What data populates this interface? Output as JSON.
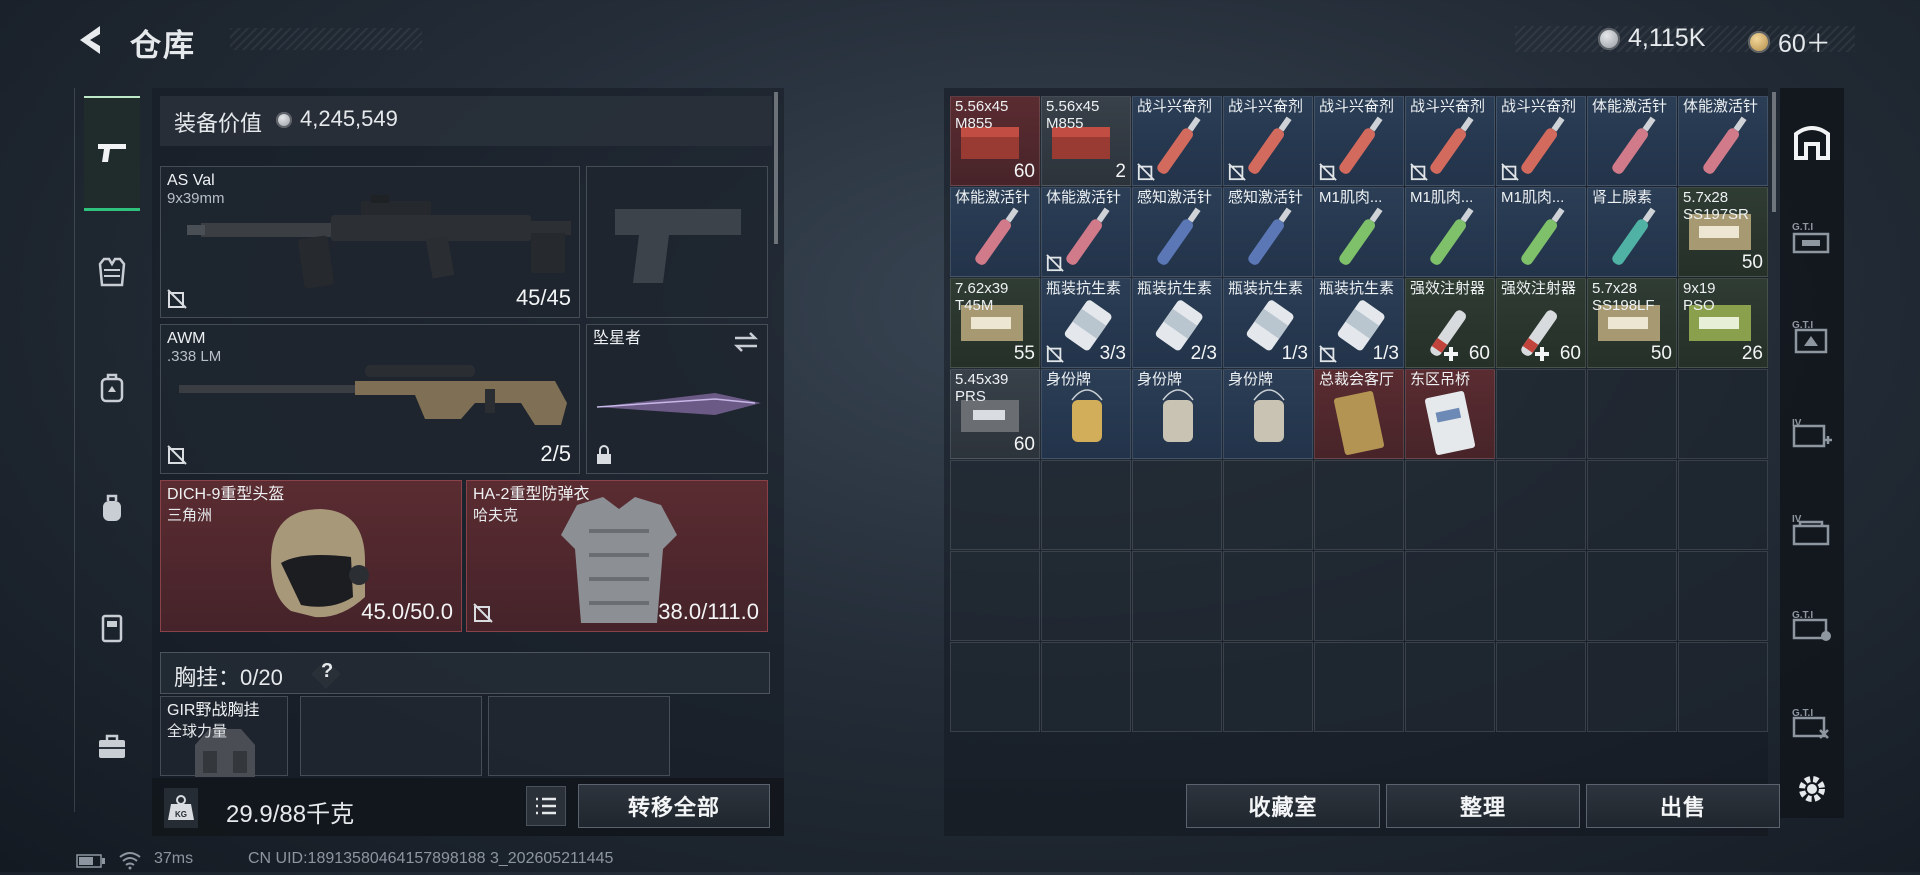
{
  "header": {
    "title": "仓库",
    "currency_1": "4,115K",
    "currency_2": "60＋"
  },
  "equipment": {
    "label": "装备价值",
    "value": "4,245,549",
    "primary_1": {
      "name": "AS Val",
      "sub": "9x39mm",
      "count": "45/45"
    },
    "primary_2": {
      "name": "AWM",
      "sub": ".338 LM",
      "count": "2/5"
    },
    "melee": {
      "name": "坠星者"
    },
    "helmet": {
      "name": "DICH-9重型头盔",
      "sub": "三角洲",
      "count": "45.0/50.0"
    },
    "armor": {
      "name": "HA-2重型防弹衣",
      "sub": "哈夫克",
      "count": "38.0/111.0"
    },
    "chest_rig_label": "胸挂：",
    "chest_rig_count": "0/20",
    "chest_rig_help": "?",
    "rig_item": {
      "name": "GIR野战胸挂",
      "sub": "全球力量"
    }
  },
  "bottom_left": {
    "weight": "29.9/88千克",
    "transfer_all": "转移全部"
  },
  "stash": {
    "rows": [
      [
        {
          "n1": "5.56x45",
          "n2": "M855",
          "count": "60",
          "kind": "ammo_red",
          "bg": "redc"
        },
        {
          "n1": "5.56x45",
          "n2": "M855",
          "count": "2",
          "kind": "ammo_red",
          "bg": "grey"
        },
        {
          "n1": "战斗兴奋剂",
          "count": "",
          "kind": "syringe_red",
          "bg": "blue",
          "broken": true
        },
        {
          "n1": "战斗兴奋剂",
          "count": "",
          "kind": "syringe_red",
          "bg": "blue",
          "broken": true
        },
        {
          "n1": "战斗兴奋剂",
          "count": "",
          "kind": "syringe_red",
          "bg": "blue",
          "broken": true
        },
        {
          "n1": "战斗兴奋剂",
          "count": "",
          "kind": "syringe_red",
          "bg": "blue",
          "broken": true
        },
        {
          "n1": "战斗兴奋剂",
          "count": "",
          "kind": "syringe_red",
          "bg": "blue",
          "broken": true
        },
        {
          "n1": "体能激活针",
          "count": "",
          "kind": "syringe_pink",
          "bg": "blue"
        },
        {
          "n1": "体能激活针",
          "count": "",
          "kind": "syringe_pink",
          "bg": "blue"
        }
      ],
      [
        {
          "n1": "体能激活针",
          "count": "",
          "kind": "syringe_pink",
          "bg": "blue"
        },
        {
          "n1": "体能激活针",
          "count": "",
          "kind": "syringe_pink",
          "bg": "blue",
          "broken": true
        },
        {
          "n1": "感知激活针",
          "count": "",
          "kind": "syringe_blue",
          "bg": "blue"
        },
        {
          "n1": "感知激活针",
          "count": "",
          "kind": "syringe_blue",
          "bg": "blue"
        },
        {
          "n1": "M1肌肉...",
          "count": "",
          "kind": "syringe_green",
          "bg": "blue"
        },
        {
          "n1": "M1肌肉...",
          "count": "",
          "kind": "syringe_green",
          "bg": "blue"
        },
        {
          "n1": "M1肌肉...",
          "count": "",
          "kind": "syringe_green",
          "bg": "blue"
        },
        {
          "n1": "肾上腺素",
          "count": "",
          "kind": "syringe_teal",
          "bg": "blue"
        },
        {
          "n1": "5.7x28",
          "n2": "SS197SR",
          "count": "50",
          "kind": "ammo_khaki",
          "bg": "green"
        }
      ],
      [
        {
          "n1": "7.62x39",
          "n2": "T45M",
          "count": "55",
          "kind": "ammo_khaki",
          "bg": "green"
        },
        {
          "n1": "瓶装抗生素",
          "count": "3/3",
          "kind": "bottle",
          "bg": "blue",
          "broken": true
        },
        {
          "n1": "瓶装抗生素",
          "count": "2/3",
          "kind": "bottle",
          "bg": "blue"
        },
        {
          "n1": "瓶装抗生素",
          "count": "1/3",
          "kind": "bottle",
          "bg": "blue"
        },
        {
          "n1": "瓶装抗生素",
          "count": "1/3",
          "kind": "bottle",
          "bg": "blue",
          "broken": true
        },
        {
          "n1": "强效注射器",
          "count": "60",
          "kind": "syringe_white",
          "bg": "green",
          "plus": true
        },
        {
          "n1": "强效注射器",
          "count": "60",
          "kind": "syringe_white",
          "bg": "green",
          "plus": true
        },
        {
          "n1": "5.7x28",
          "n2": "SS198LF",
          "count": "50",
          "kind": "ammo_khaki",
          "bg": "green"
        },
        {
          "n1": "9x19",
          "n2": "PSO",
          "count": "26",
          "kind": "ammo_green",
          "bg": "green"
        }
      ],
      [
        {
          "n1": "5.45x39",
          "n2": "PRS",
          "count": "60",
          "kind": "ammo_grey",
          "bg": "grey"
        },
        {
          "n1": "身份牌",
          "count": "",
          "kind": "tag_gold",
          "bg": "blue"
        },
        {
          "n1": "身份牌",
          "count": "",
          "kind": "tag_silver",
          "bg": "blue"
        },
        {
          "n1": "身份牌",
          "count": "",
          "kind": "tag_silver",
          "bg": "blue"
        },
        {
          "n1": "总裁会客厅",
          "count": "",
          "kind": "card_gold",
          "bg": "redc"
        },
        {
          "n1": "东区吊桥",
          "count": "",
          "kind": "card_white",
          "bg": "redc"
        }
      ]
    ],
    "columns": 9,
    "total_rows": 7
  },
  "bottom_right": {
    "collection": "收藏室",
    "sort": "整理",
    "sell": "出售"
  },
  "status": {
    "ping": "37ms",
    "uid": "CN UID:18913580464157898188 3_202605211445"
  },
  "colors": {
    "accent_green": "#2fc27c",
    "slot_red": "#5a2c31",
    "slot_blue": "#2b3e55",
    "slot_green": "#2f3c33"
  }
}
